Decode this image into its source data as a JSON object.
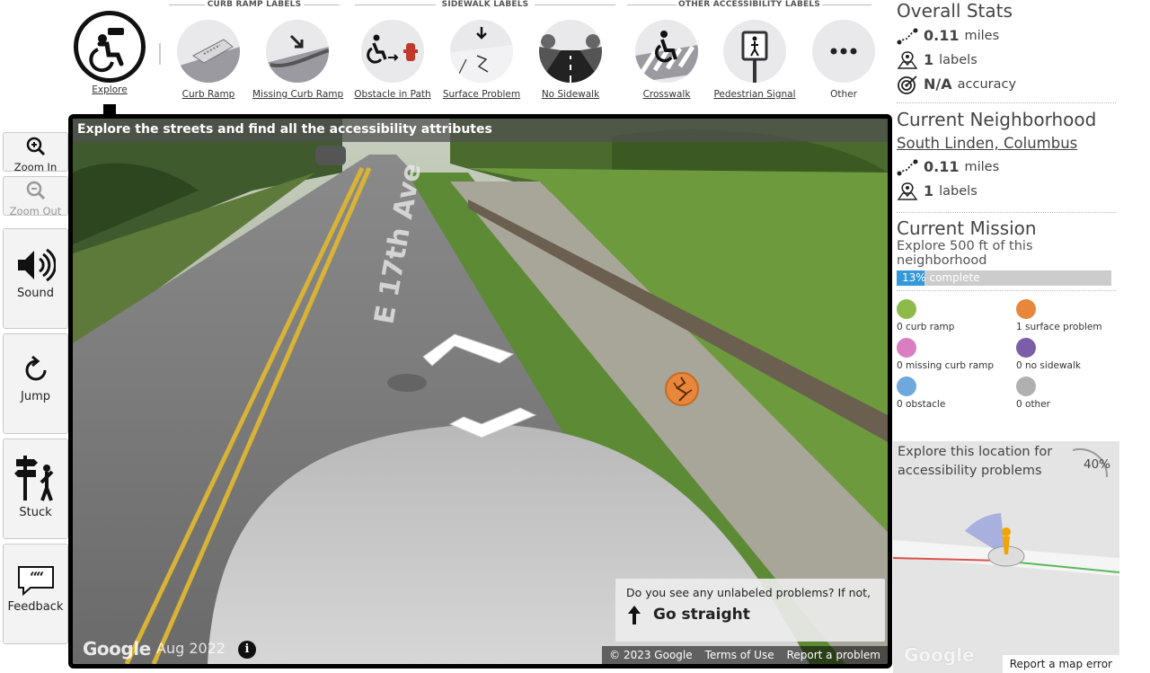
{
  "toolbar": {
    "groups": {
      "curb": "CURB RAMP LABELS",
      "sidewalk": "SIDEWALK LABELS",
      "other": "OTHER ACCESSIBILITY LABELS"
    },
    "tools": {
      "explore": {
        "label": "Explore",
        "icon": "binocular-wheelchair-icon"
      },
      "curb_ramp": {
        "label": "Curb Ramp",
        "icon": "curb-ramp-icon"
      },
      "missing_curb_ramp": {
        "label": "Missing Curb Ramp",
        "icon": "missing-curb-ramp-icon"
      },
      "obstacle": {
        "label": "Obstacle in Path",
        "icon": "obstacle-icon"
      },
      "surface": {
        "label": "Surface Problem",
        "icon": "surface-problem-icon"
      },
      "no_sidewalk": {
        "label": "No Sidewalk",
        "icon": "no-sidewalk-icon"
      },
      "crosswalk": {
        "label": "Crosswalk",
        "icon": "crosswalk-icon"
      },
      "ped_signal": {
        "label": "Pedestrian Signal",
        "icon": "pedestrian-signal-icon"
      },
      "other": {
        "label": "Other",
        "icon": "ellipsis-icon"
      }
    }
  },
  "sidebar": {
    "zoom_in": "Zoom In",
    "zoom_out": "Zoom Out",
    "sound": "Sound",
    "jump": "Jump",
    "stuck": "Stuck",
    "feedback": "Feedback"
  },
  "pano": {
    "title": "Explore the streets and find all the accessibility attributes",
    "street_label": "E 17th Ave",
    "nav_question": "Do you see any unlabeled problems? If not,",
    "nav_action": "Go straight",
    "google": "Google",
    "date": "Aug 2022",
    "info": "i",
    "copyright": "© 2023 Google",
    "terms": "Terms of Use",
    "report": "Report a problem"
  },
  "overall": {
    "title": "Overall Stats",
    "miles_value": "0.11",
    "miles_unit": "miles",
    "labels_value": "1",
    "labels_unit": "labels",
    "accuracy_value": "N/A",
    "accuracy_unit": "accuracy"
  },
  "neighborhood": {
    "title": "Current Neighborhood",
    "name": "South Linden, Columbus",
    "miles_value": "0.11",
    "miles_unit": "miles",
    "labels_value": "1",
    "labels_unit": "labels"
  },
  "mission": {
    "title": "Current Mission",
    "text": "Explore 500 ft of this neighborhood",
    "progress_text": "13% complete",
    "progress": 0.13
  },
  "label_counts": {
    "curb_ramp": "0 curb ramp",
    "surface_problem": "1 surface problem",
    "missing_curb_ramp": "0 missing curb ramp",
    "no_sidewalk": "0 no sidewalk",
    "obstacle": "0 obstacle",
    "other": "0 other"
  },
  "minimap": {
    "header": "Explore this location for accessibility problems",
    "percent": "40%",
    "google": "Google",
    "report_error": "Report a map error"
  },
  "colors": {
    "curb_ramp": "#8dbb4a",
    "missing_curb_ramp": "#d97fbf",
    "obstacle": "#6fa8dc",
    "surface_problem": "#e8863c",
    "no_sidewalk": "#7b5ea7",
    "other": "#b0b0b0",
    "progress": "#3498db"
  }
}
